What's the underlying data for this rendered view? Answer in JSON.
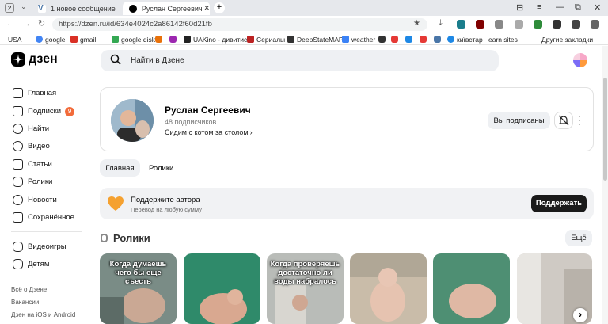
{
  "browser": {
    "tab_counter": "2",
    "tabs": [
      {
        "label": "1 новое сообщение"
      },
      {
        "label": "Руслан Сергеевич | Дзен"
      }
    ],
    "new_tab": "+",
    "url": "https://dzen.ru/id/634e4024c2a86142f60d21fb",
    "bookmarks": [
      {
        "label": "USA"
      },
      {
        "label": "google"
      },
      {
        "label": "gmail"
      },
      {
        "label": "google disk"
      },
      {
        "label": "UAKino - дивитис"
      },
      {
        "label": "Сериалы"
      },
      {
        "label": "DeepStateMAP"
      },
      {
        "label": "weather"
      },
      {
        "label": "київстар"
      },
      {
        "label": "earn sites"
      }
    ],
    "other_bookmarks": "Другие закладки"
  },
  "header": {
    "logo_text": "дзен",
    "search_placeholder": "Найти в Дзене"
  },
  "sidebar": {
    "items": [
      {
        "label": "Главная",
        "icon": "home-icon"
      },
      {
        "label": "Подписки",
        "icon": "subscriptions-icon",
        "badge": "9"
      },
      {
        "label": "Найти",
        "icon": "search-icon"
      },
      {
        "label": "Видео",
        "icon": "video-icon"
      },
      {
        "label": "Статьи",
        "icon": "articles-icon"
      },
      {
        "label": "Ролики",
        "icon": "clips-icon"
      },
      {
        "label": "Новости",
        "icon": "news-icon"
      },
      {
        "label": "Сохранённое",
        "icon": "saved-icon"
      }
    ],
    "items2": [
      {
        "label": "Видеоигры",
        "icon": "gamepad-icon"
      },
      {
        "label": "Детям",
        "icon": "kids-icon"
      }
    ],
    "footer": [
      "Всё о Дзене",
      "Вакансии",
      "Дзен на iOS и Android"
    ]
  },
  "profile": {
    "name": "Руслан Сергеевич",
    "subscribers": "48 подписчиков",
    "description": "Сидим с котом за столом",
    "subscribed_button": "Вы подписаны"
  },
  "tabs": [
    "Главная",
    "Ролики"
  ],
  "support": {
    "title": "Поддержите автора",
    "subtitle": "Перевод на любую сумму",
    "button": "Поддержать"
  },
  "clips": {
    "title": "Ролики",
    "more_button": "Ещё",
    "items": [
      {
        "caption": "Когда думаешь чего бы еще съесть",
        "color": "#6d8a82"
      },
      {
        "caption": "",
        "color": "#2f8a6a"
      },
      {
        "caption": "Когда проверяешь достаточно ли воды набралось",
        "color": "#b9bcb8"
      },
      {
        "caption": "",
        "color": "#c9bca9"
      },
      {
        "caption": "",
        "color": "#4e8f73"
      },
      {
        "caption": "",
        "color": "#cfcac4"
      }
    ]
  },
  "colors": {
    "accent": "#ff4d1a",
    "badge": "#f26b3a"
  }
}
